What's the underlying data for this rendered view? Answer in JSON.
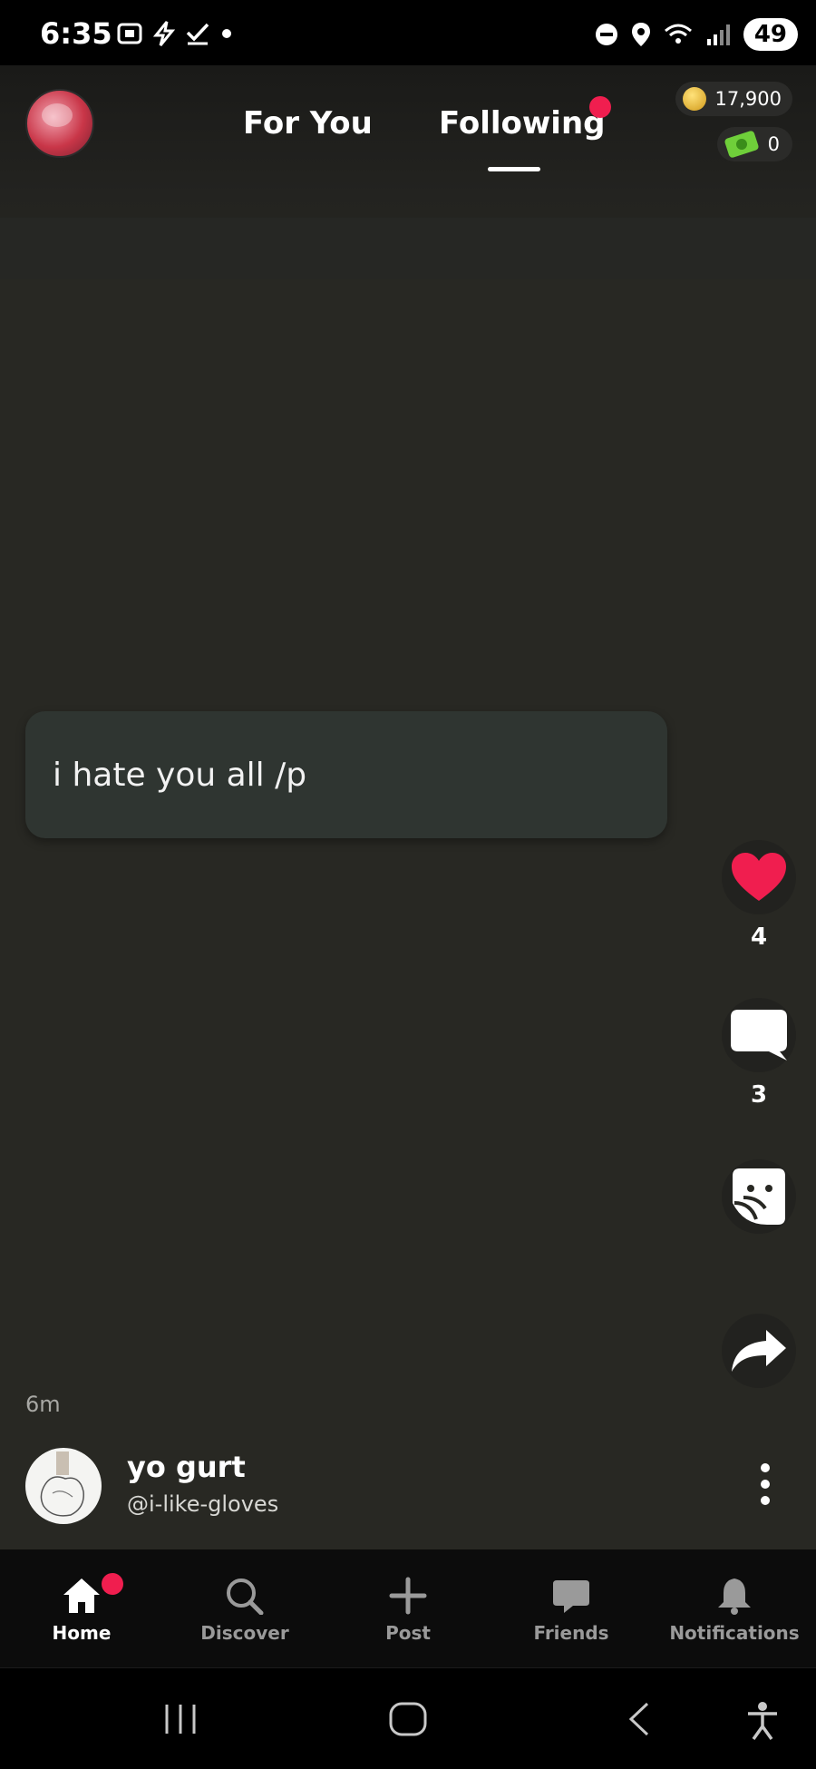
{
  "status_bar": {
    "time": "6:35",
    "battery": "49"
  },
  "header": {
    "tabs": [
      {
        "label": "For You",
        "active": false
      },
      {
        "label": "Following",
        "active": true
      }
    ],
    "coins": "17,900",
    "cash": "0",
    "colors": {
      "accent": "#f01e4f"
    }
  },
  "post": {
    "text": "i hate you all  /p",
    "time_ago": "6m",
    "likes": "4",
    "comments": "3",
    "author": {
      "name": "yo gurt",
      "handle": "@i-like-gloves"
    }
  },
  "bottom_nav": {
    "items": [
      {
        "label": "Home",
        "icon": "home-icon",
        "active": true
      },
      {
        "label": "Discover",
        "icon": "search-icon",
        "active": false
      },
      {
        "label": "Post",
        "icon": "plus-icon",
        "active": false
      },
      {
        "label": "Friends",
        "icon": "chat-bubble-icon",
        "active": false
      },
      {
        "label": "Notifications",
        "icon": "bell-icon",
        "active": false
      }
    ]
  }
}
